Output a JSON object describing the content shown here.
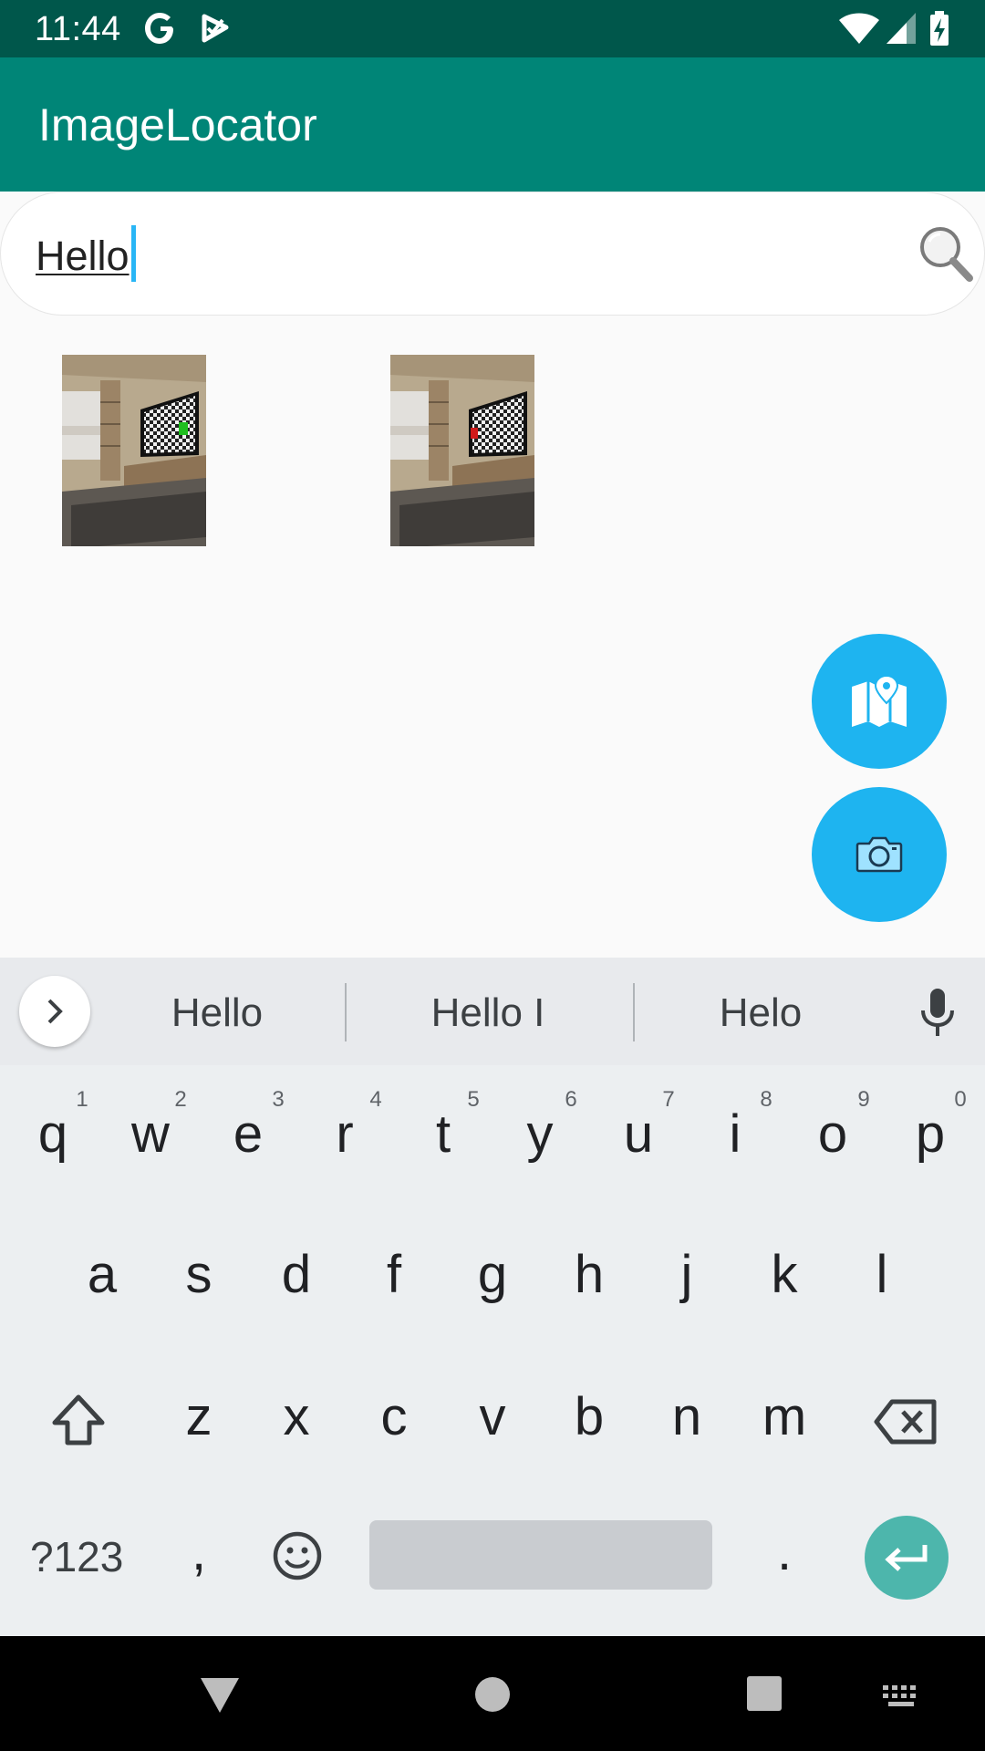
{
  "status_bar": {
    "time": "11:44"
  },
  "app_bar": {
    "title": "ImageLocator"
  },
  "search": {
    "value": "Hello"
  },
  "thumbnails": [
    {
      "marker_color": "#1fbf1f"
    },
    {
      "marker_color": "#d11a1a"
    }
  ],
  "keyboard": {
    "suggestions": [
      "Hello",
      "Hello I",
      "Helo"
    ],
    "row1": [
      {
        "key": "q",
        "hint": "1"
      },
      {
        "key": "w",
        "hint": "2"
      },
      {
        "key": "e",
        "hint": "3"
      },
      {
        "key": "r",
        "hint": "4"
      },
      {
        "key": "t",
        "hint": "5"
      },
      {
        "key": "y",
        "hint": "6"
      },
      {
        "key": "u",
        "hint": "7"
      },
      {
        "key": "i",
        "hint": "8"
      },
      {
        "key": "o",
        "hint": "9"
      },
      {
        "key": "p",
        "hint": "0"
      }
    ],
    "row2": [
      "a",
      "s",
      "d",
      "f",
      "g",
      "h",
      "j",
      "k",
      "l"
    ],
    "row3": [
      "z",
      "x",
      "c",
      "v",
      "b",
      "n",
      "m"
    ],
    "symbols_label": "?123",
    "comma": ",",
    "period": "."
  },
  "colors": {
    "status_bar": "#00574b",
    "app_bar": "#008577",
    "fab": "#1eb4f0",
    "enter_key": "#4db6ac",
    "caret": "#29b6f6"
  },
  "icons": {
    "status": [
      "google-g-icon",
      "task-check-icon",
      "wifi-icon",
      "signal-icon",
      "battery-charging-icon"
    ],
    "search": "search-icon",
    "fab_map": "map-pin-icon",
    "fab_camera": "camera-icon",
    "suggest_toggle": "chevron-right-icon",
    "voice": "mic-icon",
    "shift": "shift-icon",
    "backspace": "backspace-icon",
    "emoji": "emoji-icon",
    "enter": "enter-icon",
    "nav": [
      "back-icon",
      "home-icon",
      "recents-icon",
      "keyboard-switch-icon"
    ]
  }
}
